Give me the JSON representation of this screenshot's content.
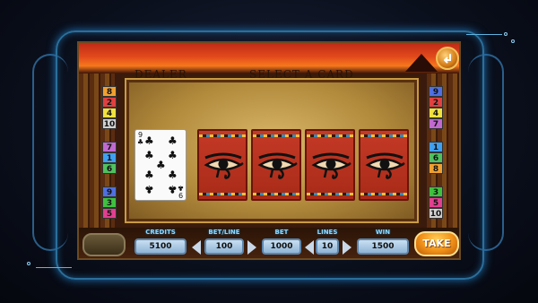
{
  "header": {
    "exit_icon": "exit-arrow-icon"
  },
  "panel": {
    "dealer_label": "DEALER",
    "prompt_label": "SELECT A CARD"
  },
  "dealer_card": {
    "rank": "9",
    "suit": "♣",
    "suit_name": "clubs"
  },
  "player_cards": [
    {
      "face": "back",
      "icon": "eye-of-horus-icon"
    },
    {
      "face": "back",
      "icon": "eye-of-horus-icon"
    },
    {
      "face": "back",
      "icon": "eye-of-horus-icon"
    },
    {
      "face": "back",
      "icon": "eye-of-horus-icon"
    }
  ],
  "paylines": {
    "left": [
      {
        "num": "8",
        "color": "#f0a030"
      },
      {
        "num": "2",
        "color": "#e04040"
      },
      {
        "num": "4",
        "color": "#f0e040"
      },
      {
        "num": "10",
        "color": "#d0d0d0"
      },
      {
        "num": "7",
        "color": "#c06ad0"
      },
      {
        "num": "1",
        "color": "#40a0f0"
      },
      {
        "num": "6",
        "color": "#50c060"
      },
      {
        "num": "9",
        "color": "#5070e0"
      },
      {
        "num": "3",
        "color": "#40c040"
      },
      {
        "num": "5",
        "color": "#e04090"
      }
    ],
    "right": [
      {
        "num": "9",
        "color": "#5070e0"
      },
      {
        "num": "2",
        "color": "#e04040"
      },
      {
        "num": "4",
        "color": "#f0e040"
      },
      {
        "num": "7",
        "color": "#c06ad0"
      },
      {
        "num": "1",
        "color": "#40a0f0"
      },
      {
        "num": "6",
        "color": "#50c060"
      },
      {
        "num": "8",
        "color": "#f0a030"
      },
      {
        "num": "3",
        "color": "#40c040"
      },
      {
        "num": "5",
        "color": "#e04090"
      },
      {
        "num": "10",
        "color": "#d0d0d0"
      }
    ]
  },
  "stats": {
    "credits_label": "CREDITS",
    "credits_value": "5100",
    "betline_label": "BET/LINE",
    "betline_value": "100",
    "bet_label": "BET",
    "bet_value": "1000",
    "lines_label": "LINES",
    "lines_value": "10",
    "win_label": "WIN",
    "win_value": "1500"
  },
  "take_button": "TAKE"
}
